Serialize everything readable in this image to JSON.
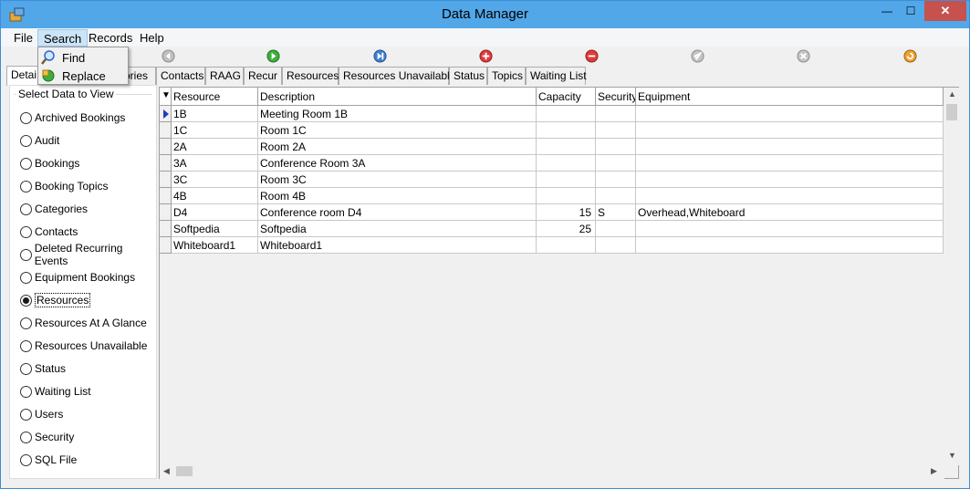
{
  "window": {
    "title": "Data Manager"
  },
  "menu": {
    "items": [
      {
        "label": "File"
      },
      {
        "label": "Search"
      },
      {
        "label": "Records"
      },
      {
        "label": "Help"
      }
    ]
  },
  "search_menu": {
    "items": [
      {
        "label": "Find",
        "icon": "magnifier-icon"
      },
      {
        "label": "Replace",
        "icon": "replace-icon"
      }
    ]
  },
  "toolbar": {
    "buttons": [
      {
        "icon": "first-record-icon",
        "color": "#9a9a9a"
      },
      {
        "icon": "next-record-icon",
        "color": "#2e9b2e"
      },
      {
        "icon": "last-record-icon",
        "color": "#2a69c8"
      },
      {
        "icon": "add-record-icon",
        "color": "#d22b2b"
      },
      {
        "icon": "delete-record-icon",
        "color": "#d22b2b"
      },
      {
        "icon": "edit-record-icon",
        "color": "#9a9a9a"
      },
      {
        "icon": "cancel-edit-icon",
        "color": "#9a9a9a"
      },
      {
        "icon": "refresh-icon",
        "color": "#f08c1e"
      }
    ]
  },
  "tabs": [
    {
      "label": "Detai"
    },
    {
      "label": "ories"
    },
    {
      "label": "Contacts"
    },
    {
      "label": "RAAG"
    },
    {
      "label": "Recur"
    },
    {
      "label": "Resources"
    },
    {
      "label": "Resources Unavailable"
    },
    {
      "label": "Status"
    },
    {
      "label": "Topics"
    },
    {
      "label": "Waiting List"
    }
  ],
  "left_panel": {
    "group_label": "Select Data to View",
    "options": [
      {
        "label": "Archived Bookings",
        "checked": false
      },
      {
        "label": "Audit",
        "checked": false
      },
      {
        "label": "Bookings",
        "checked": false
      },
      {
        "label": "Booking Topics",
        "checked": false
      },
      {
        "label": "Categories",
        "checked": false
      },
      {
        "label": "Contacts",
        "checked": false
      },
      {
        "label": "Deleted Recurring Events",
        "checked": false
      },
      {
        "label": "Equipment Bookings",
        "checked": false
      },
      {
        "label": "Resources",
        "checked": true
      },
      {
        "label": "Resources At A Glance",
        "checked": false
      },
      {
        "label": "Resources Unavailable",
        "checked": false
      },
      {
        "label": "Status",
        "checked": false
      },
      {
        "label": "Waiting List",
        "checked": false
      },
      {
        "label": "Users",
        "checked": false
      },
      {
        "label": "Security",
        "checked": false
      },
      {
        "label": "SQL File",
        "checked": false
      }
    ]
  },
  "grid": {
    "sort_glyph": "▼",
    "columns": [
      "Resource",
      "Description",
      "Capacity",
      "Security",
      "Equipment"
    ],
    "rows": [
      {
        "resource": "1B",
        "description": "Meeting Room 1B",
        "capacity": "",
        "security": "",
        "equipment": "",
        "current": true
      },
      {
        "resource": "1C",
        "description": "Room 1C",
        "capacity": "",
        "security": "",
        "equipment": "",
        "current": false
      },
      {
        "resource": "2A",
        "description": "Room 2A",
        "capacity": "",
        "security": "",
        "equipment": "",
        "current": false
      },
      {
        "resource": "3A",
        "description": "Conference Room 3A",
        "capacity": "",
        "security": "",
        "equipment": "",
        "current": false
      },
      {
        "resource": "3C",
        "description": "Room 3C",
        "capacity": "",
        "security": "",
        "equipment": "",
        "current": false
      },
      {
        "resource": "4B",
        "description": "Room 4B",
        "capacity": "",
        "security": "",
        "equipment": "",
        "current": false
      },
      {
        "resource": "D4",
        "description": "Conference room D4",
        "capacity": "15",
        "security": "S",
        "equipment": "Overhead,Whiteboard",
        "current": false
      },
      {
        "resource": "Softpedia",
        "description": "Softpedia",
        "capacity": "25",
        "security": "",
        "equipment": "",
        "current": false
      },
      {
        "resource": "Whiteboard1",
        "description": "Whiteboard1",
        "capacity": "",
        "security": "",
        "equipment": "",
        "current": false
      }
    ]
  }
}
